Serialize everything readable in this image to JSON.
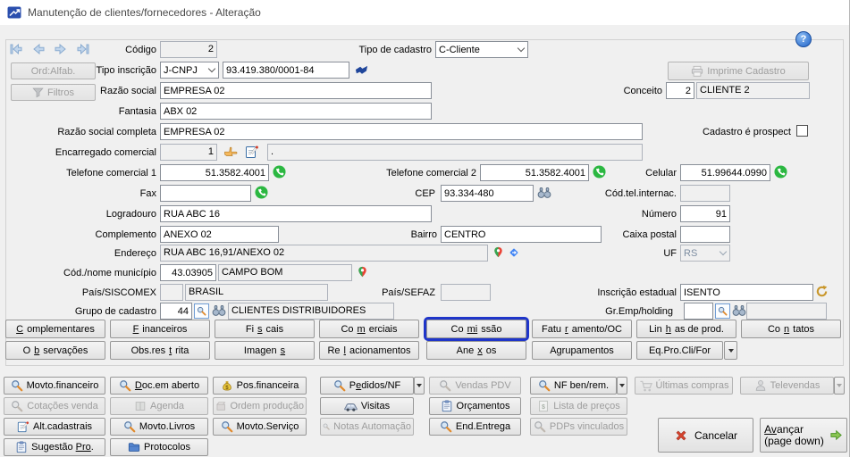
{
  "window": {
    "title": "Manutenção de clientes/fornecedores - Alteração",
    "help": "?"
  },
  "colors": {
    "focus_accent": "#1f35c9",
    "whatsapp_green": "#2bb741",
    "cancel_red": "#d8442e",
    "advance_green": "#8bc653",
    "disabled_text": "#9d9d9d",
    "window_bg": "#f0f0f0"
  },
  "icons": {
    "app": "chart-arrows",
    "nav": [
      "first-record",
      "previous-record",
      "next-record",
      "last-record"
    ],
    "filter": "funnel",
    "print": "printer",
    "phone": "whatsapp-circle",
    "lookup": "magnifier-in-box",
    "search": "binoculars",
    "map": "google-maps-pin",
    "directions": "blue-directions-diamond",
    "cnpj": "receita-federal",
    "hand": "pointing-hand",
    "edit": "note-with-pen",
    "state_reg": "gold-refresh"
  },
  "sidebar": {
    "ord_alfab": "Ord:Alfab.",
    "filtros": "Filtros"
  },
  "fields": {
    "codigo": {
      "label": "Código",
      "value": "2"
    },
    "tipo_cadastro": {
      "label": "Tipo de cadastro",
      "value": "C-Cliente"
    },
    "tipo_inscricao": {
      "label": "Tipo inscrição",
      "value": "J-CNPJ",
      "numero": "93.419.380/0001-84"
    },
    "imprime_cadastro": {
      "label": "Imprime Cadastro"
    },
    "razao_social": {
      "label": "Razão social",
      "value": "EMPRESA 02"
    },
    "conceito": {
      "label": "Conceito",
      "code": "2",
      "desc": "CLIENTE 2"
    },
    "fantasia": {
      "label": "Fantasia",
      "value": "ABX 02"
    },
    "razao_social_completa": {
      "label": "Razão social completa",
      "value": "EMPRESA 02"
    },
    "prospect": {
      "label": "Cadastro é prospect",
      "checked": false
    },
    "encarregado_comercial": {
      "label": "Encarregado comercial",
      "code": "1",
      "desc": "."
    },
    "telefone1": {
      "label": "Telefone comercial 1",
      "value": "51.3582.4001"
    },
    "telefone2": {
      "label": "Telefone comercial 2",
      "value": "51.3582.4001"
    },
    "celular": {
      "label": "Celular",
      "value": "51.99644.0990"
    },
    "fax": {
      "label": "Fax",
      "value": ""
    },
    "cep": {
      "label": "CEP",
      "value": "93.334-480"
    },
    "cod_tel_internac": {
      "label": "Cód.tel.internac.",
      "value": ""
    },
    "logradouro": {
      "label": "Logradouro",
      "value": "RUA ABC 16"
    },
    "numero": {
      "label": "Número",
      "value": "91"
    },
    "complemento": {
      "label": "Complemento",
      "value": "ANEXO 02"
    },
    "bairro": {
      "label": "Bairro",
      "value": "CENTRO"
    },
    "caixa_postal": {
      "label": "Caixa postal",
      "value": ""
    },
    "endereco": {
      "label": "Endereço",
      "value": "RUA ABC 16,91/ANEXO 02"
    },
    "uf": {
      "label": "UF",
      "value": "RS"
    },
    "municipio": {
      "label": "Cód./nome município",
      "code": "43.03905",
      "name": "CAMPO BOM"
    },
    "pais_siscomex": {
      "label": "País/SISCOMEX",
      "code": "",
      "name": "BRASIL"
    },
    "pais_sefaz": {
      "label": "País/SEFAZ",
      "value": ""
    },
    "inscricao_estadual": {
      "label": "Inscrição estadual",
      "value": "ISENTO"
    },
    "grupo_cadastro": {
      "label": "Grupo de cadastro",
      "code": "44",
      "desc": "CLIENTES DISTRIBUIDORES"
    },
    "gr_emp_holding": {
      "label": "Gr.Emp/holding",
      "code": "",
      "desc": ""
    }
  },
  "tabs": {
    "row1": [
      {
        "label": "Complementares",
        "accel": 0
      },
      {
        "label": "Financeiros",
        "accel": 0
      },
      {
        "label": "Fiscais",
        "accel": 2
      },
      {
        "label": "Comerciais",
        "accel": 2
      },
      {
        "label": "Comissão",
        "accel": 2,
        "accel_len": 2,
        "focused": true
      },
      {
        "label": "Faturamento/OC",
        "accel": 4
      },
      {
        "label": "Linhas de prod.",
        "accel": 3
      },
      {
        "label": "Contatos",
        "accel": 2
      }
    ],
    "row2": [
      {
        "label": "Observações",
        "accel": 1
      },
      {
        "label": "Obs.restrita",
        "accel": 7
      },
      {
        "label": "Imagens",
        "accel": 6
      },
      {
        "label": "Relacionamentos",
        "accel": 2
      },
      {
        "label": "Anexos",
        "accel": 3
      },
      {
        "label": "Agrupamentos"
      },
      {
        "label": "Eq.Pro.Cli/For",
        "dropdown": true
      }
    ]
  },
  "actions": {
    "row1": [
      {
        "label": "Movto.financeiro",
        "icon": "magnifier",
        "enabled": true
      },
      {
        "label": "Doc.em aberto",
        "accel": 0,
        "icon": "magnifier",
        "enabled": true
      },
      {
        "label": "Pos.financeira",
        "icon": "money-bag",
        "enabled": true
      },
      {
        "label": "Pedidos/NF",
        "accel": 1,
        "icon": "magnifier",
        "enabled": true,
        "dropdown": true
      },
      {
        "label": "Vendas PDV",
        "icon": "magnifier",
        "enabled": false
      },
      {
        "label": "NF ben/rem.",
        "icon": "magnifier",
        "enabled": true,
        "dropdown": true
      },
      {
        "label": "Últimas compras",
        "icon": "shopping-cart",
        "enabled": false
      },
      {
        "label": "Televendas",
        "icon": "person",
        "enabled": false,
        "dropdown": true
      }
    ],
    "row2": [
      {
        "label": "Cotações venda",
        "icon": "magnifier",
        "enabled": false
      },
      {
        "label": "Agenda",
        "accel": 1,
        "icon": "book",
        "enabled": false
      },
      {
        "label": "Ordem produção",
        "icon": "box",
        "enabled": false
      },
      {
        "label": "Visitas",
        "icon": "car",
        "enabled": true
      },
      {
        "label": "Orçamentos",
        "icon": "clipboard",
        "enabled": true
      },
      {
        "label": "Lista de preços",
        "icon": "price-list",
        "enabled": false
      }
    ],
    "row3": [
      {
        "label": "Alt.cadastrais",
        "icon": "note-edit",
        "enabled": true
      },
      {
        "label": "Movto.Livros",
        "icon": "magnifier",
        "enabled": true
      },
      {
        "label": "Movto.Serviço",
        "icon": "magnifier",
        "enabled": true
      },
      {
        "label": "Notas Automação",
        "icon": "magnifier",
        "enabled": false
      },
      {
        "label": "End.Entrega",
        "icon": "magnifier",
        "enabled": true
      },
      {
        "label": "PDPs vinculados",
        "icon": "magnifier",
        "enabled": false
      }
    ],
    "row4": [
      {
        "label": "Sugestão Pro.",
        "accel": 9,
        "accel_len": 3,
        "icon": "clipboard",
        "enabled": true
      },
      {
        "label": "Protocolos",
        "icon": "folder",
        "enabled": true
      }
    ]
  },
  "footer": {
    "cancel": {
      "label": "Cancelar"
    },
    "advance": {
      "label": "Avançar",
      "accel": 0,
      "accel_len": 2,
      "sub": "(page down)"
    }
  }
}
